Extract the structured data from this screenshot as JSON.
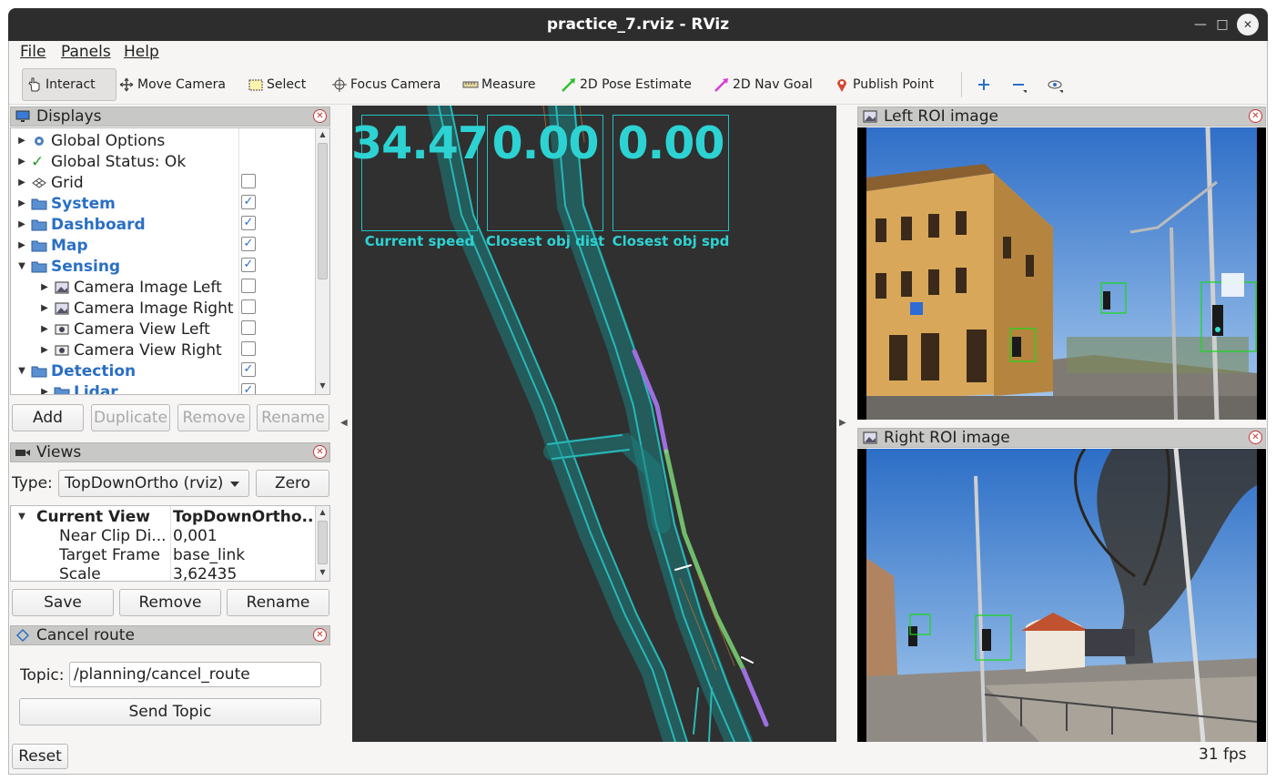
{
  "window": {
    "title": "practice_7.rviz - RViz"
  },
  "menu": [
    "File",
    "Panels",
    "Help"
  ],
  "toolbar": {
    "tools": [
      "Interact",
      "Move Camera",
      "Select",
      "Focus Camera",
      "Measure",
      "2D Pose Estimate",
      "2D Nav Goal",
      "Publish Point"
    ]
  },
  "displays": {
    "title": "Displays",
    "items": [
      {
        "label": "Global Options",
        "checked": null
      },
      {
        "label": "Global Status: Ok",
        "checked": null
      },
      {
        "label": "Grid",
        "checked": false
      },
      {
        "label": "System",
        "checked": true
      },
      {
        "label": "Dashboard",
        "checked": true
      },
      {
        "label": "Map",
        "checked": true
      },
      {
        "label": "Sensing",
        "checked": true
      },
      {
        "label": "Camera Image Left",
        "checked": false
      },
      {
        "label": "Camera Image Right",
        "checked": false
      },
      {
        "label": "Camera View Left",
        "checked": false
      },
      {
        "label": "Camera View Right",
        "checked": false
      },
      {
        "label": "Detection",
        "checked": true
      },
      {
        "label": "Lidar",
        "checked": true
      }
    ],
    "buttons": [
      "Add",
      "Duplicate",
      "Remove",
      "Rename"
    ]
  },
  "views": {
    "title": "Views",
    "type_label": "Type:",
    "type_value": "TopDownOrtho (rviz)",
    "zero_label": "Zero",
    "rows": [
      {
        "key": "Current View",
        "value": "TopDownOrtho..."
      },
      {
        "key": "Near Clip Di...",
        "value": "0,001"
      },
      {
        "key": "Target Frame",
        "value": "base_link"
      },
      {
        "key": "Scale",
        "value": "3,62435"
      }
    ],
    "buttons": [
      "Save",
      "Remove",
      "Rename"
    ]
  },
  "cancel_route": {
    "title": "Cancel route",
    "topic_label": "Topic:",
    "topic_value": "/planning/cancel_route",
    "send_label": "Send Topic"
  },
  "viewport": {
    "metrics": [
      {
        "value": "34.47",
        "label": "Current speed"
      },
      {
        "value": "0.00",
        "label": "Closest obj dist"
      },
      {
        "value": "0.00",
        "label": "Closest obj spd"
      }
    ],
    "colors": {
      "metric": "#2dd3d3",
      "lane": "#1e9a9a",
      "background": "#303030"
    }
  },
  "images": {
    "left_title": "Left ROI image",
    "right_title": "Right ROI image"
  },
  "status": {
    "reset_label": "Reset",
    "fps": "31 fps"
  }
}
